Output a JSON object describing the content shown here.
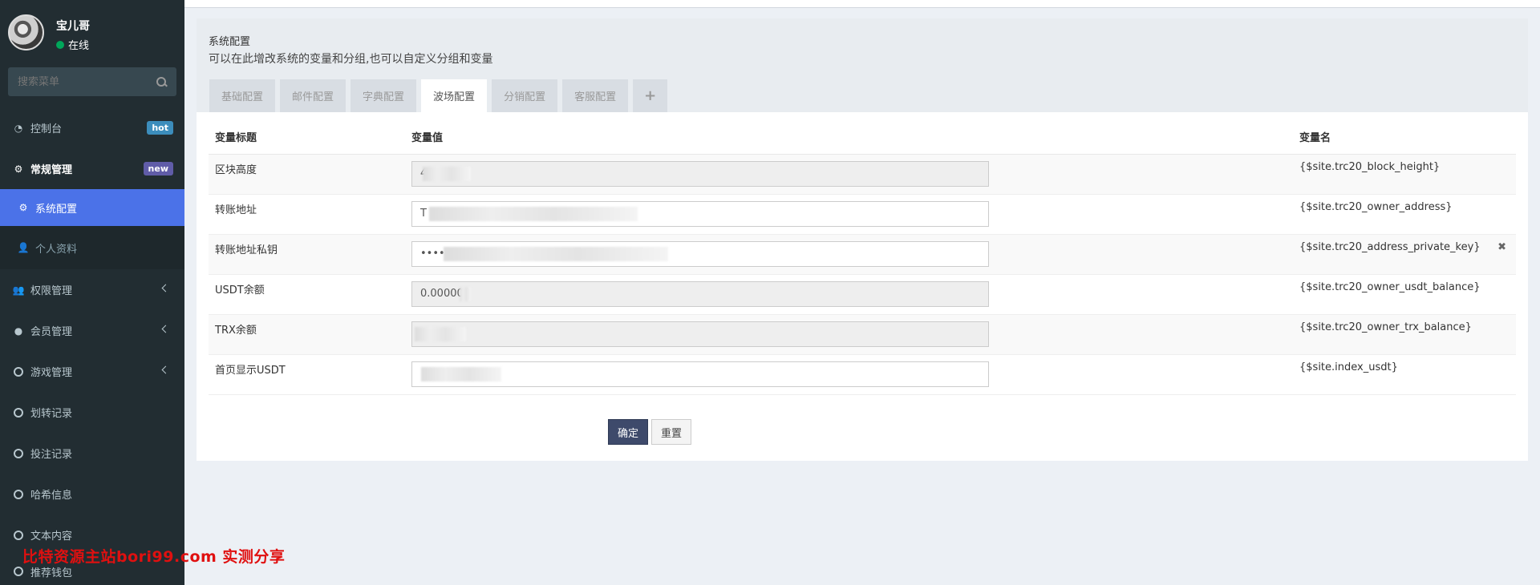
{
  "user": {
    "name": "宝儿哥",
    "status": "在线"
  },
  "search": {
    "placeholder": "搜索菜单"
  },
  "menu": {
    "dashboard": {
      "label": "控制台",
      "badge": "hot"
    },
    "general": {
      "label": "常规管理",
      "badge": "new"
    },
    "system_config": {
      "label": "系统配置"
    },
    "profile": {
      "label": "个人资料"
    },
    "permissions": {
      "label": "权限管理"
    },
    "members": {
      "label": "会员管理"
    },
    "games": {
      "label": "游戏管理"
    },
    "transfers": {
      "label": "划转记录"
    },
    "bets": {
      "label": "投注记录"
    },
    "hash": {
      "label": "哈希信息"
    },
    "content": {
      "label": "文本内容"
    },
    "wallets": {
      "label": "推荐钱包"
    }
  },
  "watermark": "比特资源主站bori99.com 实测分享",
  "panel": {
    "title": "系统配置",
    "description": "可以在此增改系统的变量和分组,也可以自定义分组和变量",
    "tabs": [
      "基础配置",
      "邮件配置",
      "字典配置",
      "波场配置",
      "分销配置",
      "客服配置"
    ],
    "add_tab": "+"
  },
  "table": {
    "headers": {
      "title": "变量标题",
      "value": "变量值",
      "name": "变量名"
    },
    "rows": [
      {
        "title": "区块高度",
        "value": "4",
        "name": "{$site.trc20_block_height}",
        "readonly": true
      },
      {
        "title": "转账地址",
        "value": "T",
        "name": "{$site.trc20_owner_address}",
        "readonly": false
      },
      {
        "title": "转账地址私钥",
        "value": "••••••",
        "name": "{$site.trc20_address_private_key}",
        "readonly": false,
        "removable": true
      },
      {
        "title": "USDT余额",
        "value": "0.000000",
        "name": "{$site.trc20_owner_usdt_balance}",
        "readonly": true
      },
      {
        "title": "TRX余额",
        "value": "",
        "name": "{$site.trc20_owner_trx_balance}",
        "readonly": true
      },
      {
        "title": "首页显示USDT",
        "value": "",
        "name": "{$site.index_usdt}",
        "readonly": false
      }
    ]
  },
  "buttons": {
    "confirm": "确定",
    "reset": "重置"
  }
}
